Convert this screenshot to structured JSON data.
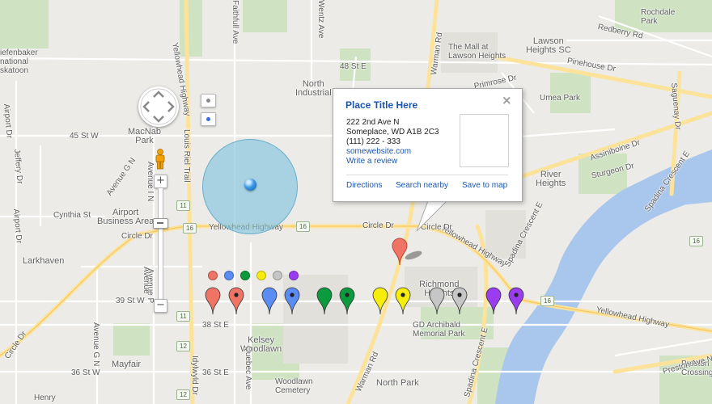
{
  "map": {
    "place_labels": [
      {
        "text": "North\nIndustrial",
        "kind": "big"
      },
      {
        "text": "Airport\nBusiness Area",
        "kind": "big"
      },
      {
        "text": "Larkhaven",
        "kind": "big"
      },
      {
        "text": "MacNab\nPark",
        "kind": "big"
      },
      {
        "text": "Richmond\nHeights",
        "kind": "big"
      },
      {
        "text": "River\nHeights",
        "kind": "big"
      },
      {
        "text": "Lawson\nHeights SC",
        "kind": "big"
      },
      {
        "text": "The Mall at\nLawson Heights",
        "kind": "small"
      },
      {
        "text": "Umea Park",
        "kind": "small"
      },
      {
        "text": "Rochdale\nPark",
        "kind": "small"
      },
      {
        "text": "Kelsey\nWoodlawn",
        "kind": "big"
      },
      {
        "text": "Mayfair",
        "kind": "big"
      },
      {
        "text": "North Park",
        "kind": "big"
      },
      {
        "text": "GD Archibald\nMemorial Park",
        "kind": "small"
      },
      {
        "text": "Woodlawn\nCemetery",
        "kind": "small"
      },
      {
        "text": "Preston\nCrossing",
        "kind": "small"
      },
      {
        "text": "Henry",
        "kind": "small"
      },
      {
        "text": "iefenbaker\nnational\nskatoon",
        "kind": "small"
      }
    ],
    "street_labels": [
      "48 St E",
      "45 St W",
      "Cynthia St",
      "Circle Dr",
      "Circle Dr",
      "Yellowhead Highway",
      "Yellowhead Highway",
      "Circle Dr",
      "39 St W",
      "38 St E",
      "36 St W",
      "36 St E",
      "Pinehouse Dr",
      "Redberry Rd",
      "Primrose Dr",
      "Assiniboine Dr",
      "Sturgeon Dr",
      "Preston Ave N",
      "Yellowhead Highway",
      "Warman Rd",
      "Warman Rd",
      "Saguenay Dr",
      "Spadina Crescent E",
      "Spadina Crescent E",
      "Spadina Crescent E",
      "Louis Riel Trail",
      "Yellowhead Highway",
      "Airport Dr",
      "Airport Dr",
      "Jeffery Dr",
      "Avenue G N",
      "Avenue I N",
      "Avenue P",
      "Quebec Ave",
      "Faithfull Ave",
      "Wentz Ave",
      "Idylwyld Dr",
      "Circle Dr",
      "Avenue G N",
      "Avenue"
    ],
    "highway_shields": [
      "11",
      "16",
      "16",
      "16",
      "16",
      "12",
      "12",
      "11"
    ]
  },
  "controls": {
    "pan_icon": "pan-arrows-icon",
    "pegman_icon": "pegman-icon",
    "zoom_in_label": "+",
    "zoom_out_label": "−",
    "zoom_in_bottom_label": "−",
    "zoom_level_fraction": 0.3,
    "view_buttons": [
      "radio-off",
      "radio-on"
    ]
  },
  "info_window": {
    "title": "Place Title Here",
    "close_icon": "×",
    "address_line1": "222 2nd Ave N",
    "address_line2": "Someplace, WD A1B 2C3",
    "phone": "(111) 222 - 333",
    "website": "somewebsite.com",
    "review_link": "Write a review",
    "actions": [
      "Directions",
      "Search nearby",
      "Save to map"
    ]
  },
  "marker_colors": {
    "red": "#ef7465",
    "blue": "#5a8cf2",
    "green": "#0c9a3f",
    "yellow": "#f6ee0a",
    "gray": "#c6c6c6",
    "purple": "#9a3df1"
  },
  "swatches": [
    "red",
    "blue",
    "green",
    "yellow",
    "gray",
    "purple"
  ],
  "pins": [
    {
      "color": "red",
      "dot": false
    },
    {
      "color": "red",
      "dot": true
    },
    {
      "color": "blue",
      "dot": false
    },
    {
      "color": "blue",
      "dot": true
    },
    {
      "color": "green",
      "dot": false
    },
    {
      "color": "green",
      "dot": true
    },
    {
      "color": "yellow",
      "dot": false
    },
    {
      "color": "yellow",
      "dot": true
    },
    {
      "color": "gray",
      "dot": false
    },
    {
      "color": "gray",
      "dot": true
    },
    {
      "color": "purple",
      "dot": false
    },
    {
      "color": "purple",
      "dot": true
    }
  ],
  "location_marker_color": "#ef7465",
  "accuracy_circle_color": "#7ec1dd"
}
